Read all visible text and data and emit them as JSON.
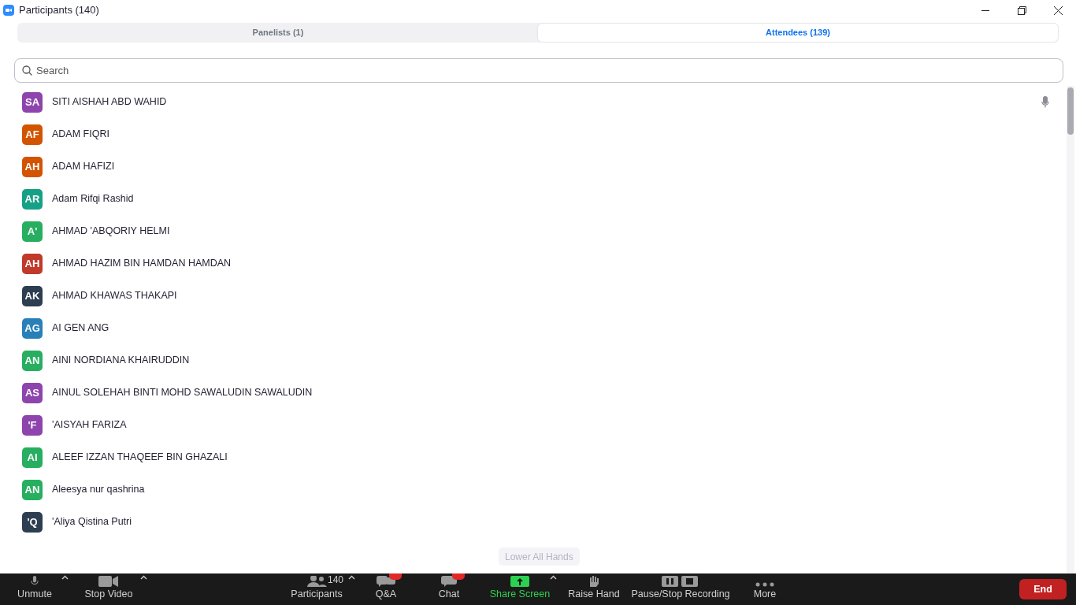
{
  "window": {
    "title": "Participants (140)"
  },
  "tabs": [
    {
      "label": "Panelists (1)",
      "selected": false
    },
    {
      "label": "Attendees (139)",
      "selected": true
    }
  ],
  "search": {
    "placeholder": "Search"
  },
  "participants": [
    {
      "initials": "SA",
      "name": "SITI AISHAH ABD WAHID",
      "color": "#8e44ad",
      "mic": true
    },
    {
      "initials": "AF",
      "name": "ADAM FIQRI",
      "color": "#d35400",
      "mic": false
    },
    {
      "initials": "AH",
      "name": "ADAM HAFIZI",
      "color": "#d35400",
      "mic": false
    },
    {
      "initials": "AR",
      "name": "Adam Rifqi Rashid",
      "color": "#16a085",
      "mic": false
    },
    {
      "initials": "A'",
      "name": "AHMAD 'ABQORIY HELMI",
      "color": "#27ae60",
      "mic": false
    },
    {
      "initials": "AH",
      "name": "AHMAD HAZIM BIN HAMDAN HAMDAN",
      "color": "#c0392b",
      "mic": false
    },
    {
      "initials": "AK",
      "name": "AHMAD KHAWAS THAKAPI",
      "color": "#2c3e50",
      "mic": false
    },
    {
      "initials": "AG",
      "name": "AI GEN ANG",
      "color": "#2980b9",
      "mic": false
    },
    {
      "initials": "AN",
      "name": "AINI NORDIANA KHAIRUDDIN",
      "color": "#27ae60",
      "mic": false
    },
    {
      "initials": "AS",
      "name": "AINUL SOLEHAH BINTI MOHD SAWALUDIN SAWALUDIN",
      "color": "#8e44ad",
      "mic": false
    },
    {
      "initials": "'F",
      "name": "'AISYAH FARIZA",
      "color": "#8e44ad",
      "mic": false
    },
    {
      "initials": "AI",
      "name": "ALEEF IZZAN THAQEEF BIN GHAZALI",
      "color": "#27ae60",
      "mic": false
    },
    {
      "initials": "AN",
      "name": "Aleesya nur qashrina",
      "color": "#27ae60",
      "mic": false
    },
    {
      "initials": "'Q",
      "name": "'Aliya Qistina Putri",
      "color": "#2c3e50",
      "mic": false
    }
  ],
  "lower_all_hands": {
    "label": "Lower All Hands",
    "disabled": true
  },
  "toolbar": {
    "left": [
      {
        "kind": "mic",
        "label": "Unmute",
        "caret": true
      },
      {
        "kind": "video",
        "label": "Stop Video",
        "caret": true
      }
    ],
    "center": [
      {
        "kind": "people",
        "label": "Participants",
        "count": "140",
        "caret": true
      },
      {
        "kind": "qa",
        "label": "Q&A",
        "badge": true
      },
      {
        "kind": "chat",
        "label": "Chat",
        "badge": true
      },
      {
        "kind": "share",
        "label": "Share Screen",
        "caret": true,
        "highlight": true
      },
      {
        "kind": "hand",
        "label": "Raise Hand"
      },
      {
        "kind": "record",
        "label": "Pause/Stop Recording"
      },
      {
        "kind": "more",
        "label": "More"
      }
    ],
    "end": {
      "label": "End"
    }
  }
}
